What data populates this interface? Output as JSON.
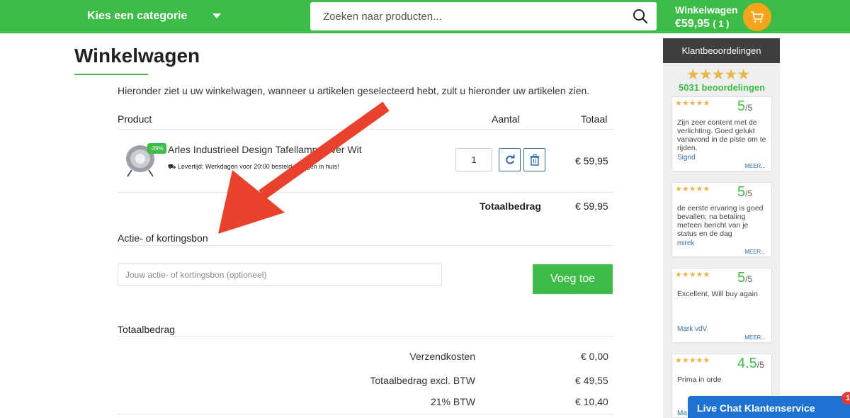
{
  "header": {
    "category_label": "Kies een categorie",
    "search_placeholder": "Zoeken naar producten...",
    "cart_label": "Winkelwagen",
    "cart_amount": "€59,95",
    "cart_count": "( 1 )"
  },
  "page": {
    "title": "Winkelwagen",
    "intro": "Hieronder ziet u uw winkelwagen, wanneer u artikelen geselecteerd hebt, zult u hieronder uw artikelen zien."
  },
  "cart_table": {
    "headers": {
      "product": "Product",
      "quantity": "Aantal",
      "total": "Totaal"
    },
    "items": [
      {
        "discount_badge": "-39%",
        "name": "Arles Industrieel Design Tafellamp Zilver Wit",
        "delivery": "⛟ Levertijd: Werkdagen voor 20:00 besteld, morgen in huis!",
        "quantity": "1",
        "total": "€ 59,95"
      }
    ],
    "subtotal_label": "Totaalbedrag",
    "subtotal_value": "€ 59,95"
  },
  "coupon": {
    "heading": "Actie- of kortingsbon",
    "placeholder": "Jouw actie- of kortingsbon (optioneel)",
    "button_label": "Voeg toe"
  },
  "summary": {
    "heading": "Totaalbedrag",
    "rows": [
      {
        "label": "Verzendkosten",
        "value": "€ 0,00"
      },
      {
        "label": "Totaalbedrag excl. BTW",
        "value": "€ 49,55"
      },
      {
        "label": "21% BTW",
        "value": "€ 10,40"
      }
    ]
  },
  "reviews_sidebar": {
    "heading": "Klantbeoordelingen",
    "overall_stars": "★★★★★",
    "count_label": "5031 beoordelingen",
    "reviews": [
      {
        "stars": "★★★★★",
        "score": "5",
        "out_of": "/5",
        "text": "Zijn zeer content met de verlichting. Goed gelukt vanavond in de piste om te rijden.",
        "author": "Sigrid",
        "more": "MEER..."
      },
      {
        "stars": "★★★★★",
        "score": "5",
        "out_of": "/5",
        "text": "de eerste ervaring is goed bevallen; na betaling meteen bericht van je status en de dag",
        "author": "mirek",
        "more": "MEER..."
      },
      {
        "stars": "★★★★★",
        "score": "5",
        "out_of": "/5",
        "text": "Excellent, Will buy again",
        "author": "Mark vdV",
        "more": "MEER..."
      },
      {
        "stars": "★★★★★",
        "score": "4.5",
        "out_of": "/5",
        "text": "Prima in orde",
        "author": "Ma",
        "more": ""
      }
    ]
  },
  "chat": {
    "label": "Live Chat Klantenservice",
    "badge": "1"
  },
  "colors": {
    "brand_green": "#3dbd48",
    "cart_orange": "#f4a51c",
    "arrow_red": "#e8412c",
    "chat_blue": "#1e73d2"
  }
}
